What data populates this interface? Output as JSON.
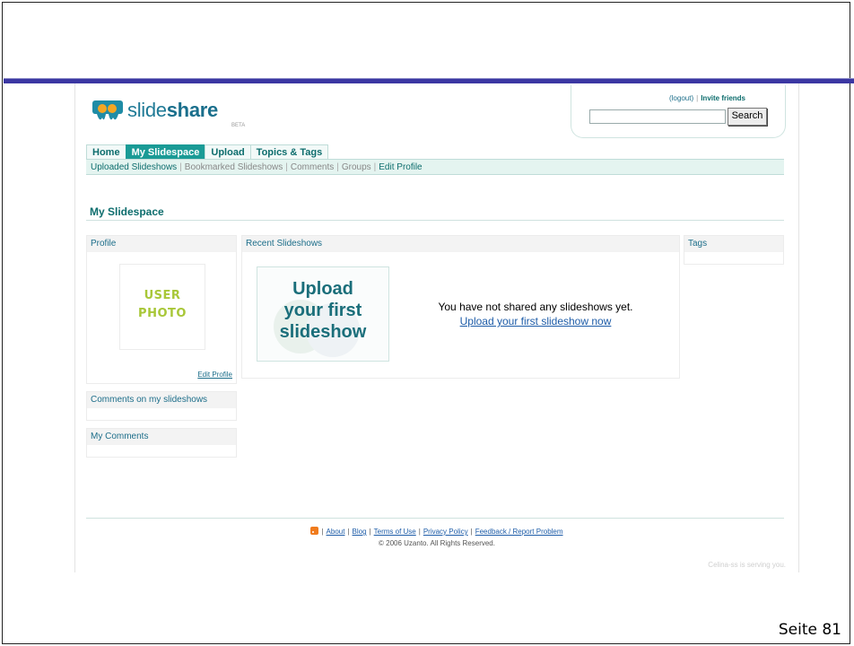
{
  "logo": {
    "name": "slideshare",
    "prefix": "slide",
    "suffix": "share",
    "beta": "BETA"
  },
  "account": {
    "logout": "logout",
    "invite": "Invite friends",
    "search_button": "Search",
    "search_value": ""
  },
  "tabs": [
    {
      "label": "Home",
      "active": false
    },
    {
      "label": "My Slidespace",
      "active": true
    },
    {
      "label": "Upload",
      "active": false
    },
    {
      "label": "Topics & Tags",
      "active": false
    }
  ],
  "subnav": {
    "uploaded": "Uploaded Slideshows",
    "bookmarked": "Bookmarked Slideshows",
    "comments": "Comments",
    "groups": "Groups",
    "edit_profile": "Edit Profile"
  },
  "page_title": "My Slidespace",
  "profile": {
    "heading": "Profile",
    "photo_line1": "USER",
    "photo_line2": "PHOTO",
    "edit_link": "Edit Profile"
  },
  "comments_on_slideshows": "Comments on my slideshows",
  "my_comments": "My Comments",
  "recent": {
    "heading": "Recent Slideshows",
    "tile_line1": "Upload",
    "tile_line2": "your first",
    "tile_line3": "slideshow",
    "empty_message": "You have not shared any slideshows yet.",
    "empty_link": "Upload your first slideshow now"
  },
  "tags_heading": "Tags",
  "footer": {
    "about": "About",
    "blog": "Blog",
    "terms": "Terms of Use",
    "privacy": "Privacy Policy",
    "feedback": "Feedback / Report Problem",
    "copyright": "© 2006 Uzanto. All Rights Reserved.",
    "serving": "Celina-ss is serving you."
  },
  "slide": {
    "page_label": "Seite 81"
  },
  "colors": {
    "accent": "#1a9b96",
    "rule": "#3b37a3",
    "link": "#1d5ca8"
  }
}
